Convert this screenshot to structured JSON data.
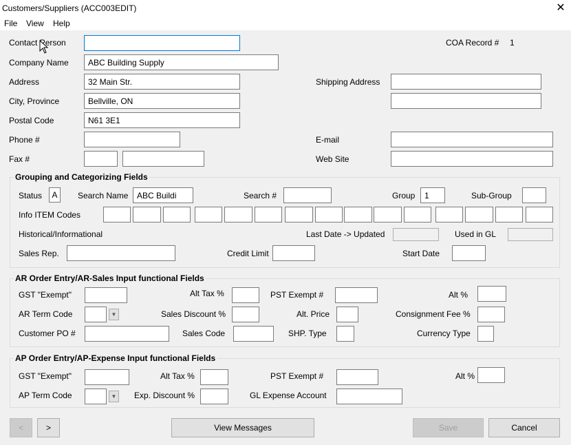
{
  "window": {
    "title": "Customers/Suppliers (ACC003EDIT)",
    "close_glyph": "✕"
  },
  "menu": [
    "File",
    "View",
    "Help"
  ],
  "contact": {
    "contact_person_label": "Contact Person",
    "contact_person_value": "",
    "coa_record_label": "COA Record #",
    "coa_record_value": "1",
    "company_name_label": "Company Name",
    "company_name_value": "ABC Building Supply",
    "address_label": "Address",
    "address_value": "32 Main Str.",
    "shipping_address_label": "Shipping Address",
    "shipping_address_1": "",
    "shipping_address_2": "",
    "city_label": "City, Province",
    "city_value": "Bellville, ON",
    "postal_label": "Postal Code",
    "postal_value": "N61 3E1",
    "phone_label": "Phone #",
    "phone_value": "",
    "email_label": "E-mail",
    "email_value": "",
    "fax_label": "Fax #",
    "fax_area": "",
    "fax_number": "",
    "web_label": "Web Site",
    "web_value": ""
  },
  "grouping": {
    "title": "Grouping and Categorizing Fields",
    "status_label": "Status",
    "status_value": "A",
    "search_name_label": "Search Name",
    "search_name_value": "ABC Buildi",
    "search_num_label": "Search #",
    "search_num_value": "",
    "group_label": "Group",
    "group_value": "1",
    "subgroup_label": "Sub-Group",
    "subgroup_value": "",
    "info_codes_label": "Info ITEM Codes",
    "info_codes": [
      "",
      "",
      "",
      "",
      "",
      "",
      "",
      "",
      "",
      "",
      "",
      "",
      "",
      "",
      ""
    ],
    "historical_label": "Historical/Informational",
    "last_date_label": "Last Date -> Updated",
    "last_date_value": "",
    "used_in_gl_label": "Used in GL",
    "used_in_gl_value": "",
    "sales_rep_label": "Sales Rep.",
    "sales_rep_value": "",
    "credit_limit_label": "Credit Limit",
    "credit_limit_value": "",
    "start_date_label": "Start Date",
    "start_date_value": ""
  },
  "ar": {
    "title": "AR   Order Entry/AR-Sales Input functional Fields",
    "gst_label": "GST \"Exempt\"",
    "gst_value": "",
    "alt_tax_label": "Alt Tax %",
    "alt_tax_value": "",
    "pst_label": "PST Exempt #",
    "pst_value": "",
    "alt_pct_label": "Alt %",
    "alt_pct_value": "",
    "term_label": "AR Term Code",
    "term_value": "",
    "sales_disc_label": "Sales Discount %",
    "sales_disc_value": "",
    "alt_price_label": "Alt. Price",
    "alt_price_value": "",
    "consign_label": "Consignment Fee %",
    "consign_value": "",
    "po_label": "Customer PO #",
    "po_value": "",
    "sales_code_label": "Sales Code",
    "sales_code_value": "",
    "shp_label": "SHP. Type",
    "shp_value": "",
    "currency_label": "Currency Type",
    "currency_value": ""
  },
  "ap": {
    "title": "AP   Order Entry/AP-Expense Input functional Fields",
    "gst_label": "GST \"Exempt\"",
    "gst_value": "",
    "alt_tax_label": "Alt Tax %",
    "alt_tax_value": "",
    "pst_label": "PST Exempt #",
    "pst_value": "",
    "alt_pct_label": "Alt %",
    "alt_pct_value": "",
    "term_label": "AP Term Code",
    "term_value": "",
    "exp_disc_label": "Exp. Discount %",
    "exp_disc_value": "",
    "gl_label": "GL Expense Account",
    "gl_value": ""
  },
  "buttons": {
    "prev": "<",
    "next": ">",
    "view_messages": "View Messages",
    "save": "Save",
    "cancel": "Cancel"
  }
}
